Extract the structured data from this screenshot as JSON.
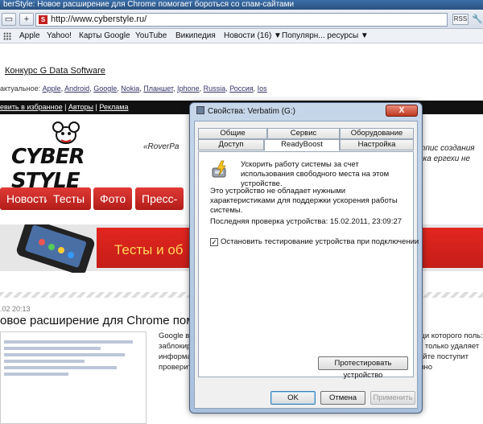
{
  "browser": {
    "window_title": "berStyle: Новое расширение для Chrome помогает бороться со спам-сайтами",
    "url": "http://www.cyberstyle.ru/",
    "rss_label": "RSS",
    "favicon_letter": "S",
    "bookmarks": [
      "Apple",
      "Yahoo!",
      "Карты Google",
      "YouTube",
      "Википедия",
      "Новости (16) ▼",
      "Популярн... ресурсы ▼"
    ]
  },
  "site": {
    "ad_title": "Конкурс G Data Software",
    "topics_prefix": "актуальное:",
    "topics": [
      "Apple",
      "Android",
      "Google",
      "Nokia",
      "Планшет",
      "Iphone",
      "Russia",
      "Россия",
      "Ios"
    ],
    "top_links": [
      "евить в избранное",
      "Авторы",
      "Реклама"
    ],
    "logo_text": "CYBER STYLE",
    "tagline_left": "«RoverPa",
    "tagline_right_1": "тпис создания",
    "tagline_right_2": "ока ергехи не",
    "menu": [
      "Новости",
      "Тесты",
      "Фото",
      "Пресс-ре"
    ],
    "banner_text": "Тесты и об",
    "post_date": ".02 20:13",
    "post_headline": "овое расширение для Chrome пом",
    "body_left": [
      "Google в",
      "заблокир",
      "информа",
      "проверит"
    ],
    "body_right": [
      "щи которого поль:",
      "е только удаляет",
      "айте поступит мно"
    ]
  },
  "dialog": {
    "title": "Свойства: Verbatim (G:)",
    "close_label": "X",
    "tabs_row1": [
      "Общие",
      "Сервис",
      "Оборудование"
    ],
    "tabs_row2": [
      "Доступ",
      "ReadyBoost",
      "Настройка"
    ],
    "readyboost": {
      "description": "Ускорить работу системы за счет использования свободного места на этом устройстве.",
      "note": "Это устройство не обладает нужными характеристиками для поддержки ускорения работы системы.",
      "last_check": "Последняя проверка устройства: 15.02.2011, 23:09:27",
      "checkbox_label": "Остановить тестирование устройства при подключении",
      "checkbox_checked": true,
      "test_button": "Протестировать устройство"
    },
    "buttons": {
      "ok": "OK",
      "cancel": "Отмена",
      "apply": "Применить"
    }
  }
}
